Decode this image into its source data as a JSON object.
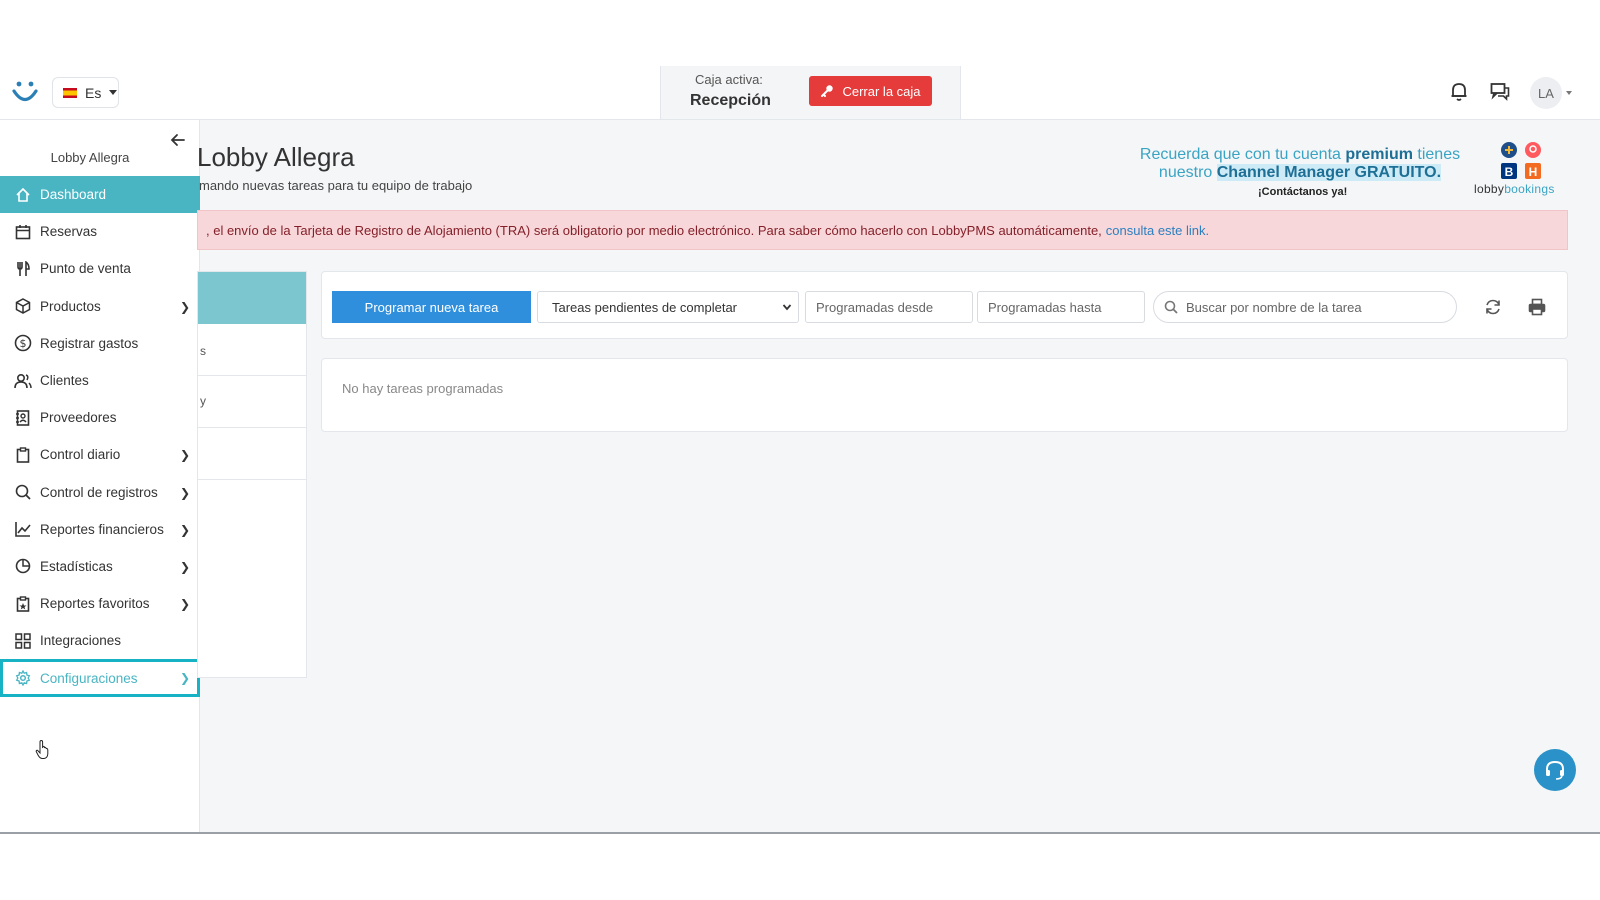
{
  "header": {
    "language": "Es",
    "cash_box_label": "Caja activa:",
    "cash_box_name": "Recepción",
    "close_box_button": "Cerrar la caja",
    "avatar_initials": "LA"
  },
  "sidebar": {
    "hotel_name": "Lobby Allegra",
    "items": [
      {
        "label": "Dashboard",
        "icon": "home-icon",
        "active": true,
        "has_submenu": false
      },
      {
        "label": "Reservas",
        "icon": "calendar-icon",
        "has_submenu": false
      },
      {
        "label": "Punto de venta",
        "icon": "utensils-icon",
        "has_submenu": false
      },
      {
        "label": "Productos",
        "icon": "box-icon",
        "has_submenu": true
      },
      {
        "label": "Registrar gastos",
        "icon": "dollar-icon",
        "has_submenu": false
      },
      {
        "label": "Clientes",
        "icon": "users-icon",
        "has_submenu": false
      },
      {
        "label": "Proveedores",
        "icon": "contacts-book-icon",
        "has_submenu": false
      },
      {
        "label": "Control diario",
        "icon": "clipboard-icon",
        "has_submenu": true
      },
      {
        "label": "Control de registros",
        "icon": "search-icon",
        "has_submenu": true
      },
      {
        "label": "Reportes financieros",
        "icon": "line-chart-icon",
        "has_submenu": true
      },
      {
        "label": "Estadísticas",
        "icon": "pie-chart-icon",
        "has_submenu": true
      },
      {
        "label": "Reportes favoritos",
        "icon": "clipboard-star-icon",
        "has_submenu": true
      },
      {
        "label": "Integraciones",
        "icon": "grid-icon",
        "has_submenu": false
      },
      {
        "label": "Configuraciones",
        "icon": "gear-icon",
        "has_submenu": true,
        "highlighted": true
      }
    ]
  },
  "main": {
    "title": "Lobby Allegra",
    "subtitle": "mando nuevas tareas para tu equipo de trabajo",
    "promo": {
      "line1_prefix": "Recuerda que con tu cuenta ",
      "line1_bold": "premium",
      "line1_suffix": " tienes",
      "line2_prefix": "nuestro ",
      "line2_highlight": "Channel Manager GRATUITO.",
      "contact": "¡Contáctanos ya!",
      "brand_prefix": "lobby",
      "brand_suffix": "bookings"
    },
    "alert": {
      "text": ", el envío de la Tarjeta de Registro de Alojamiento (TRA) será obligatorio por medio electrónico. Para saber cómo hacerlo con LobbyPMS automáticamente,",
      "link": "consulta este link."
    },
    "left_panel_rows": [
      "s",
      "y"
    ],
    "toolbar": {
      "new_task_button": "Programar nueva tarea",
      "filter_selected": "Tareas pendientes de completar",
      "date_from_placeholder": "Programadas desde",
      "date_to_placeholder": "Programadas hasta",
      "search_placeholder": "Buscar por nombre de la tarea"
    },
    "empty_message": "No hay tareas programadas"
  },
  "colors": {
    "accent": "#49b5c3",
    "primary_button": "#2f8fdd",
    "danger": "#e53b3b",
    "alert_bg": "#f8d7da",
    "highlight_outline": "#17b3c4"
  }
}
